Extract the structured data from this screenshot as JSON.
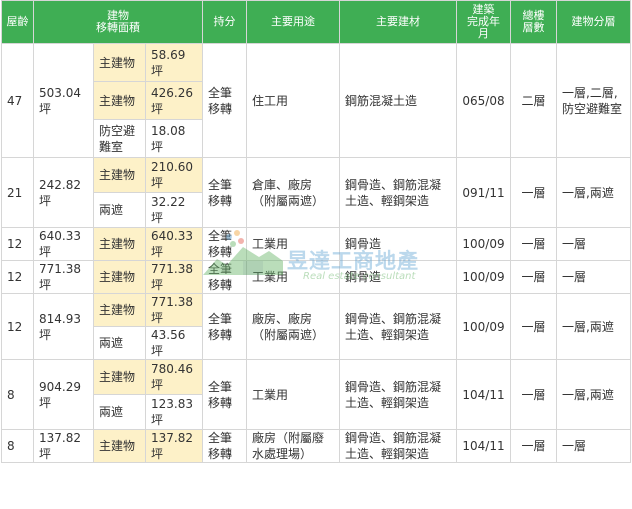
{
  "headers": {
    "floor": "屋齡",
    "area": "建物\n移轉面積",
    "share": "持分",
    "use": "主要用途",
    "material": "主要建材",
    "completed": "建築\n完成年\n月",
    "total_floors": "總樓\n層數",
    "floors": "建物分層"
  },
  "rows": [
    {
      "age": "47",
      "total_area": "503.04\n坪",
      "share": "全筆\n移轉",
      "use": "住工用",
      "material": "鋼筋混凝土造",
      "completed": "065/08",
      "total_floors": "二層",
      "floors": "一層,二層,\n防空避難室",
      "sub": [
        {
          "label": "主建物",
          "value": "58.69坪",
          "hl": true
        },
        {
          "label": "主建物",
          "value": "426.26\n坪",
          "hl": true
        },
        {
          "label": "防空避\n難室",
          "value": "18.08坪",
          "hl": false
        }
      ]
    },
    {
      "age": "21",
      "total_area": "242.82\n坪",
      "share": "全筆\n移轉",
      "use": "倉庫、廠房\n（附屬兩遮）",
      "material": "鋼骨造、鋼筋混凝\n土造、輕鋼架造",
      "completed": "091/11",
      "total_floors": "一層",
      "floors": "一層,兩遮",
      "sub": [
        {
          "label": "主建物",
          "value": "210.60\n坪",
          "hl": true
        },
        {
          "label": "兩遮",
          "value": "32.22坪",
          "hl": false
        }
      ]
    },
    {
      "age": "12",
      "total_area": "640.33\n坪",
      "share": "全筆\n移轉",
      "use": "工業用",
      "material": "鋼骨造",
      "completed": "100/09",
      "total_floors": "一層",
      "floors": "一層",
      "sub": [
        {
          "label": "主建物",
          "value": "640.33\n坪",
          "hl": true
        }
      ]
    },
    {
      "age": "12",
      "total_area": "771.38\n坪",
      "share": "全筆\n移轉",
      "use": "工業用",
      "material": "鋼骨造",
      "completed": "100/09",
      "total_floors": "一層",
      "floors": "一層",
      "sub": [
        {
          "label": "主建物",
          "value": "771.38\n坪",
          "hl": true
        }
      ]
    },
    {
      "age": "12",
      "total_area": "814.93\n坪",
      "share": "全筆\n移轉",
      "use": "廠房、廠房\n（附屬兩遮）",
      "material": "鋼骨造、鋼筋混凝\n土造、輕鋼架造",
      "completed": "100/09",
      "total_floors": "一層",
      "floors": "一層,兩遮",
      "sub": [
        {
          "label": "主建物",
          "value": "771.38\n坪",
          "hl": true
        },
        {
          "label": "兩遮",
          "value": "43.56坪",
          "hl": false
        }
      ]
    },
    {
      "age": "8",
      "total_area": "904.29\n坪",
      "share": "全筆\n移轉",
      "use": "工業用",
      "material": "鋼骨造、鋼筋混凝\n土造、輕鋼架造",
      "completed": "104/11",
      "total_floors": "一層",
      "floors": "一層,兩遮",
      "sub": [
        {
          "label": "主建物",
          "value": "780.46\n坪",
          "hl": true
        },
        {
          "label": "兩遮",
          "value": "123.83\n坪",
          "hl": false
        }
      ]
    },
    {
      "age": "8",
      "total_area": "137.82\n坪",
      "share": "全筆\n移轉",
      "use": "廠房（附屬廢\n水處理場）",
      "material": "鋼骨造、鋼筋混凝\n土造、輕鋼架造",
      "completed": "104/11",
      "total_floors": "一層",
      "floors": "一層",
      "sub": [
        {
          "label": "主建物",
          "value": "137.82\n坪",
          "hl": true
        }
      ]
    }
  ],
  "watermark": {
    "title": "昱達工商地產",
    "subtitle": "Real estate consultant"
  },
  "colors": {
    "header_bg": "#3fae54",
    "highlight_bg": "#fdf1c8",
    "border": "#d6d6d6"
  }
}
